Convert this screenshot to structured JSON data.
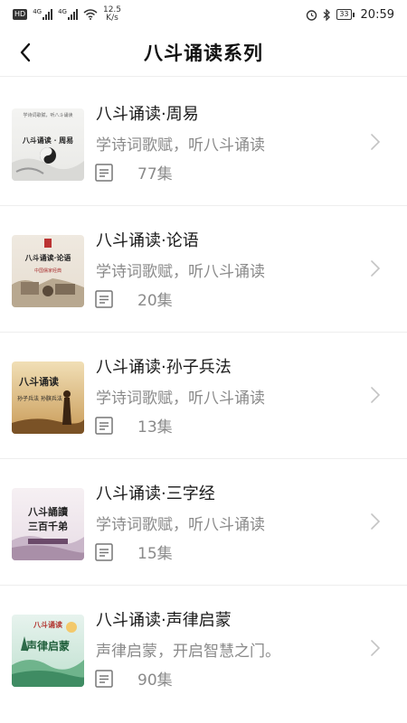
{
  "status_bar": {
    "hd": "HD",
    "net1": "4G",
    "net2": "4G",
    "speed_value": "12.5",
    "speed_unit": "K/s",
    "battery": "33",
    "time": "20:59"
  },
  "header": {
    "title": "八斗诵读系列"
  },
  "items": [
    {
      "title": "八斗诵读·周易",
      "subtitle": "学诗词歌赋，听八斗诵读",
      "count": "77集",
      "cover_text": "八斗诵读 · 周易",
      "cover_small": "学诗词歌赋，听八斗诵读"
    },
    {
      "title": "八斗诵读·论语",
      "subtitle": "学诗词歌赋，听八斗诵读",
      "count": "20集",
      "cover_text": "八斗诵读·论语",
      "cover_small": "中国儒家经典"
    },
    {
      "title": "八斗诵读·孙子兵法",
      "subtitle": "学诗词歌赋，听八斗诵读",
      "count": "13集",
      "cover_text": "八斗诵读",
      "cover_small": "孙子兵法 孙膑兵法"
    },
    {
      "title": "八斗诵读·三字经",
      "subtitle": "学诗词歌赋，听八斗诵读",
      "count": "15集",
      "cover_text": "八斗誦讀",
      "cover_small": "三百千弟"
    },
    {
      "title": "八斗诵读·声律启蒙",
      "subtitle": "声律启蒙，开启智慧之门。",
      "count": "90集",
      "cover_text": "八斗诵读",
      "cover_small": "声律启蒙"
    }
  ]
}
